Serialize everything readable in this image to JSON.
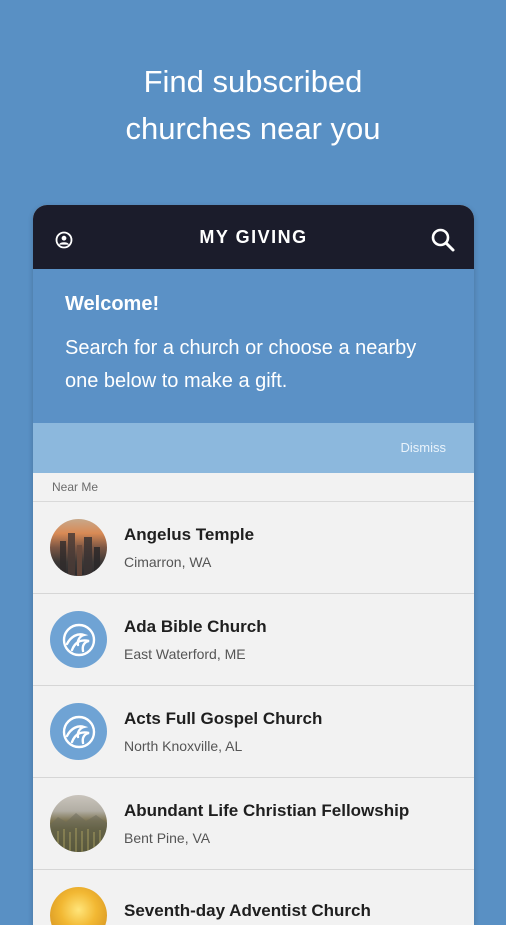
{
  "promo": {
    "line1": "Find subscribed",
    "line2": "churches near you"
  },
  "appbar": {
    "title": "MY GIVING",
    "left_icon": "profile-icon",
    "right_icon": "search-icon"
  },
  "welcome": {
    "title": "Welcome!",
    "body": "Search for a church or choose a nearby one below to make a gift."
  },
  "dismiss_label": "Dismiss",
  "section_label": "Near Me",
  "churches": [
    {
      "name": "Angelus Temple",
      "location": "Cimarron, WA",
      "avatar": "city-photo"
    },
    {
      "name": "Ada Bible Church",
      "location": "East Waterford, ME",
      "avatar": "church-logo"
    },
    {
      "name": "Acts Full Gospel Church",
      "location": "North Knoxville, AL",
      "avatar": "church-logo"
    },
    {
      "name": "Abundant Life Christian Fellowship",
      "location": "Bent Pine, VA",
      "avatar": "wheat-photo"
    },
    {
      "name": "Seventh-day Adventist Church",
      "location": "",
      "avatar": "gold-photo"
    }
  ],
  "colors": {
    "background": "#5990c4",
    "appbar": "#1b1c2b",
    "welcome": "#5b91c6",
    "dismiss_bar": "#8cb8dd",
    "list_bg": "#f2f2f2"
  }
}
